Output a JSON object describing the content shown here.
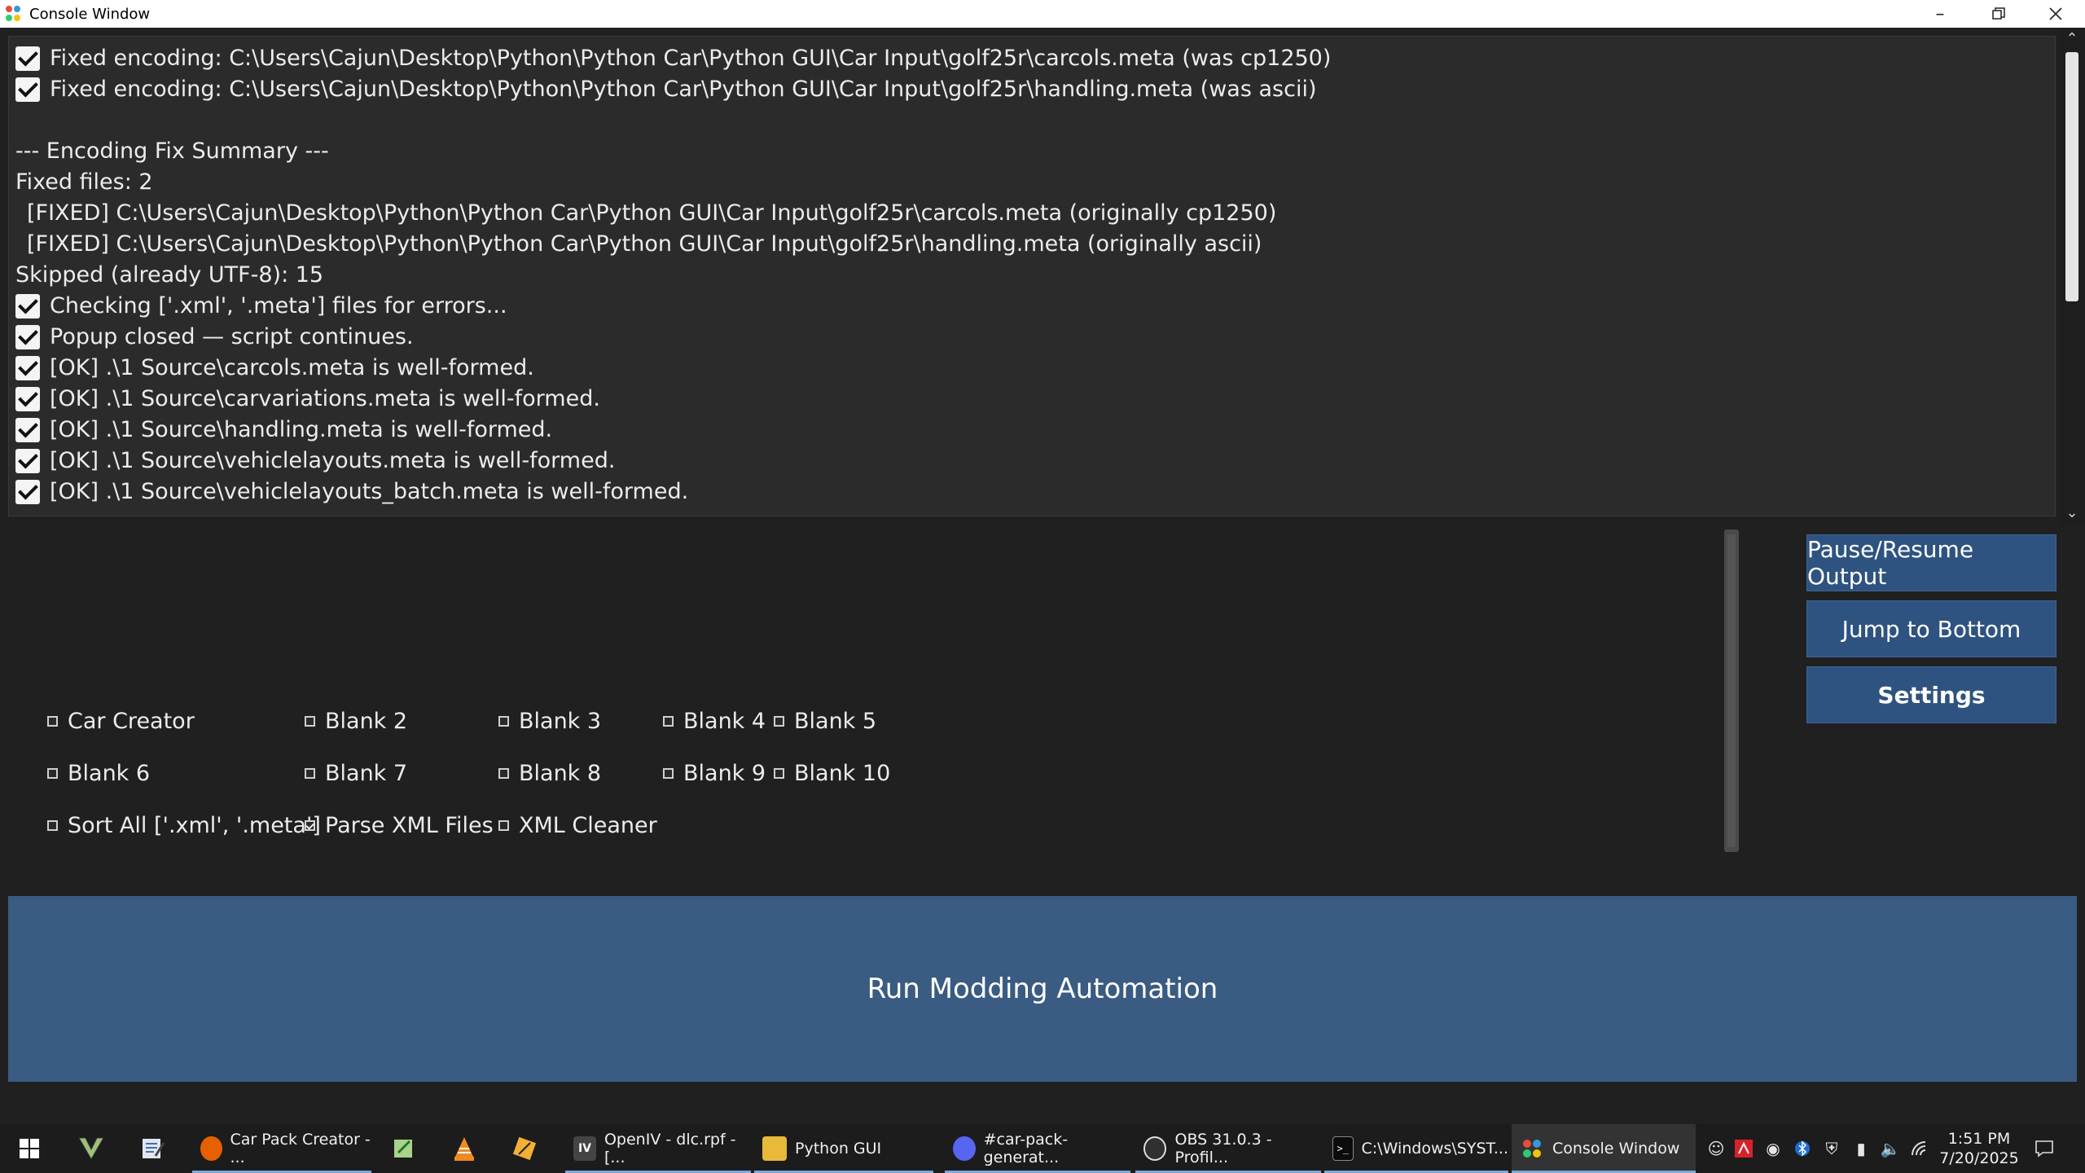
{
  "window": {
    "title": "Console Window"
  },
  "console": {
    "lines": [
      {
        "check": true,
        "text": "Fixed encoding: C:\\Users\\Cajun\\Desktop\\Python\\Python Car\\Python GUI\\Car Input\\golf25r\\carcols.meta (was cp1250)"
      },
      {
        "check": true,
        "text": "Fixed encoding: C:\\Users\\Cajun\\Desktop\\Python\\Python Car\\Python GUI\\Car Input\\golf25r\\handling.meta (was ascii)"
      },
      {
        "check": false,
        "text": ""
      },
      {
        "check": false,
        "text": "--- Encoding Fix Summary ---"
      },
      {
        "check": false,
        "text": "Fixed files: 2"
      },
      {
        "check": false,
        "indent": true,
        "text": "[FIXED] C:\\Users\\Cajun\\Desktop\\Python\\Python Car\\Python GUI\\Car Input\\golf25r\\carcols.meta (originally cp1250)"
      },
      {
        "check": false,
        "indent": true,
        "text": "[FIXED] C:\\Users\\Cajun\\Desktop\\Python\\Python Car\\Python GUI\\Car Input\\golf25r\\handling.meta (originally ascii)"
      },
      {
        "check": false,
        "text": "Skipped (already UTF-8): 15"
      },
      {
        "check": true,
        "text": "Checking ['.xml', '.meta'] files for errors..."
      },
      {
        "check": true,
        "text": "Popup closed — script continues."
      },
      {
        "check": true,
        "text": "[OK] .\\1 Source\\carcols.meta is well-formed."
      },
      {
        "check": true,
        "text": "[OK] .\\1 Source\\carvariations.meta is well-formed."
      },
      {
        "check": true,
        "text": "[OK] .\\1 Source\\handling.meta is well-formed."
      },
      {
        "check": true,
        "text": "[OK] .\\1 Source\\vehiclelayouts.meta is well-formed."
      },
      {
        "check": true,
        "text": "[OK] .\\1 Source\\vehiclelayouts_batch.meta is well-formed."
      }
    ]
  },
  "side_buttons": {
    "pause": "Pause/Resume Output",
    "jump": "Jump to Bottom",
    "settings": "Settings"
  },
  "options": [
    {
      "label": "Car Creator",
      "checked": false
    },
    {
      "label": "Blank 2",
      "checked": false
    },
    {
      "label": "Blank 3",
      "checked": false
    },
    {
      "label": "Blank 4",
      "checked": false
    },
    {
      "label": "Blank 5",
      "checked": false
    },
    {
      "label": "Blank 6",
      "checked": false
    },
    {
      "label": "Blank 7",
      "checked": false
    },
    {
      "label": "Blank 8",
      "checked": false
    },
    {
      "label": "Blank 9",
      "checked": false
    },
    {
      "label": "Blank 10",
      "checked": false
    },
    {
      "label": "Sort All ['.xml', '.meta']",
      "checked": false
    },
    {
      "label": "Parse XML Files",
      "checked": true
    },
    {
      "label": "XML Cleaner",
      "checked": false
    }
  ],
  "run_button": "Run Modding Automation",
  "taskbar": {
    "items": [
      {
        "label": "Car Pack Creator - ...",
        "icon": "firefox-icon",
        "color": "#e66000"
      },
      {
        "label": "OpenIV - dlc.rpf - [...",
        "icon": "openiv-icon",
        "color": "#444444"
      },
      {
        "label": "Python GUI",
        "icon": "folder-icon",
        "color": "#e8b93a"
      },
      {
        "label": "#car-pack-generat...",
        "icon": "discord-icon",
        "color": "#5865f2"
      },
      {
        "label": "OBS 31.0.3 - Profil...",
        "icon": "obs-icon",
        "color": "#303030"
      },
      {
        "label": "C:\\Windows\\SYST...",
        "icon": "cmd-icon",
        "color": "#0c0c0c"
      },
      {
        "label": "Console Window",
        "icon": "console-window-icon",
        "color": "#2b2b2b"
      }
    ],
    "clock_time": "1:51 PM",
    "clock_date": "7/20/2025"
  }
}
